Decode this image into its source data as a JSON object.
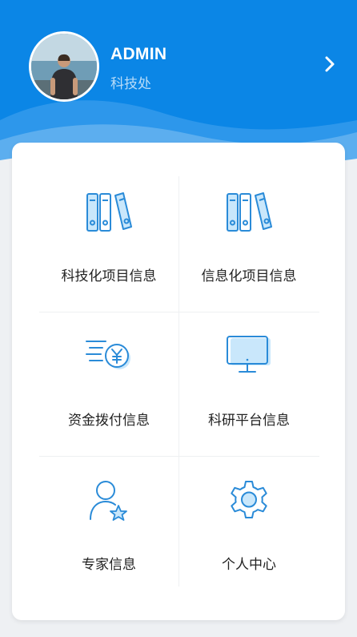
{
  "profile": {
    "username": "ADMIN",
    "department": "科技处"
  },
  "menu": {
    "items": [
      {
        "label": "科技化项目信息",
        "icon": "books-icon"
      },
      {
        "label": "信息化项目信息",
        "icon": "books-icon"
      },
      {
        "label": "资金拨付信息",
        "icon": "yuan-coin-icon"
      },
      {
        "label": "科研平台信息",
        "icon": "monitor-icon"
      },
      {
        "label": "专家信息",
        "icon": "expert-user-icon"
      },
      {
        "label": "个人中心",
        "icon": "gear-icon"
      }
    ]
  },
  "colors": {
    "header_blue": "#0b86e6",
    "icon_blue": "#2a8bd8",
    "icon_fill_light": "#c9e7fb"
  }
}
